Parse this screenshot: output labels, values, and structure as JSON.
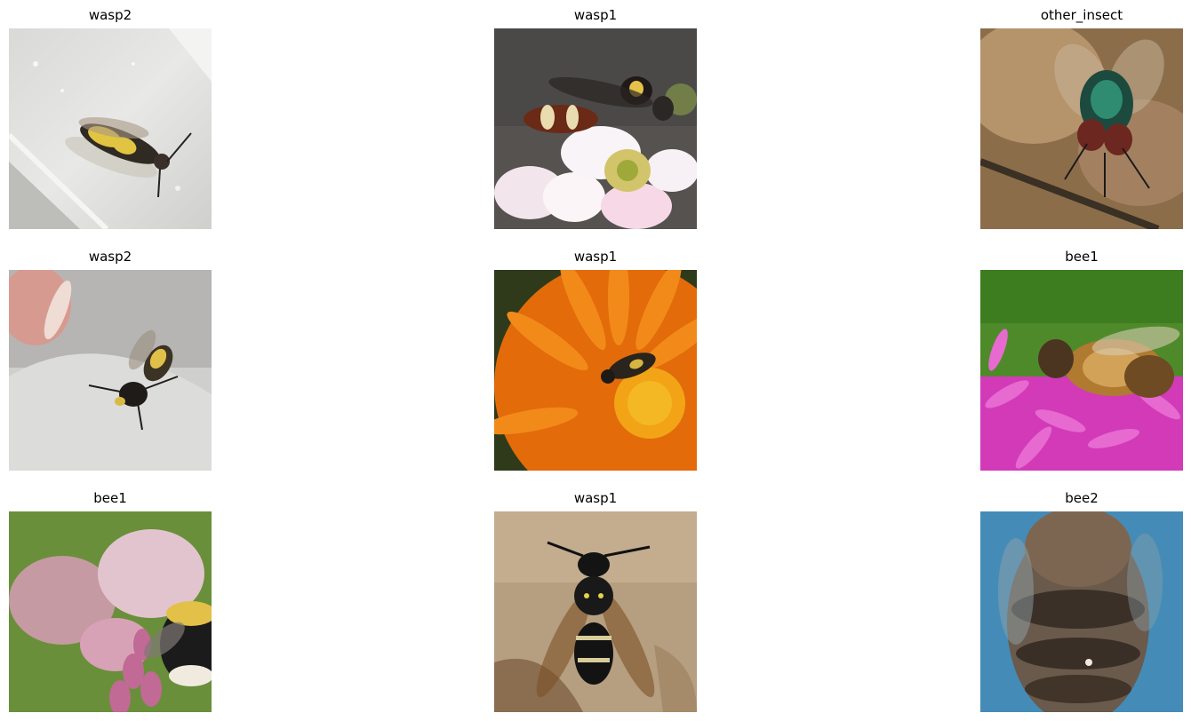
{
  "grid": {
    "cells": [
      {
        "label": "wasp2"
      },
      {
        "label": "wasp1"
      },
      {
        "label": "other_insect"
      },
      {
        "label": "wasp2"
      },
      {
        "label": "wasp1"
      },
      {
        "label": "bee1"
      },
      {
        "label": "bee1"
      },
      {
        "label": "wasp1"
      },
      {
        "label": "bee2"
      }
    ]
  }
}
